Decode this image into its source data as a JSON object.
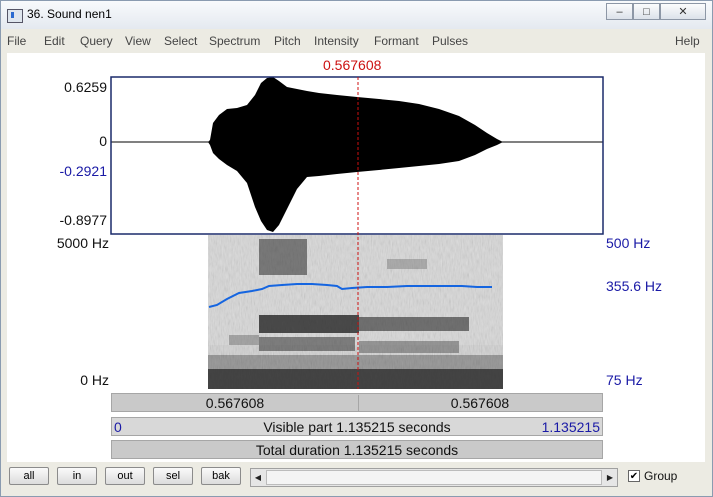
{
  "window": {
    "title": "36. Sound nen1",
    "minimize": "–",
    "maximize": "□",
    "close": "✕"
  },
  "menu": [
    "File",
    "Edit",
    "Query",
    "View",
    "Select",
    "Spectrum",
    "Pitch",
    "Intensity",
    "Formant",
    "Pulses"
  ],
  "help": "Help",
  "cursor": {
    "time_label": "0.567608",
    "time_value": 0.567608
  },
  "waveform": {
    "ymax": "0.6259",
    "zero": "0",
    "ycursor": "-0.2921",
    "ymin": "-0.8977"
  },
  "spectrogram": {
    "fmax": "5000 Hz",
    "fmin": "0 Hz"
  },
  "pitch": {
    "max": "500 Hz",
    "value": "355.6 Hz",
    "min": "75 Hz"
  },
  "bars": {
    "left_time": "0.567608",
    "right_time": "0.567608",
    "start": "0",
    "visible": "Visible part 1.135215 seconds",
    "end": "1.135215",
    "total": "Total duration 1.135215 seconds"
  },
  "buttons": [
    "all",
    "in",
    "out",
    "sel",
    "bak"
  ],
  "group": {
    "label": "Group",
    "checked": true,
    "mark": "✔"
  },
  "scroll_arrows": {
    "left": "◀",
    "right": "▶"
  },
  "colors": {
    "cursor": "#cc1111",
    "axis_blue": "#1a1aa6",
    "pitch": "#1565e0",
    "frame": "#1a2a6a"
  }
}
